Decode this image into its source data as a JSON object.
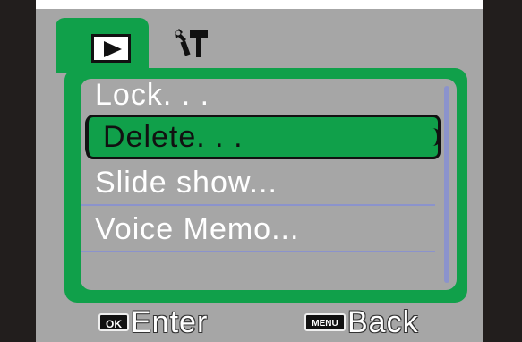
{
  "tabs": [
    {
      "icon": "play-icon",
      "active": true
    },
    {
      "icon": "tools-icon",
      "active": false
    }
  ],
  "menu": {
    "items": [
      {
        "label": "Lock. . ."
      },
      {
        "label": "Delete. . ."
      },
      {
        "label": "Slide show..."
      },
      {
        "label": "Voice Memo..."
      }
    ],
    "selected_index": 1
  },
  "footer": {
    "ok_badge": "OK",
    "ok_label": "Enter",
    "menu_badge": "MENU",
    "menu_label": "Back"
  },
  "colors": {
    "accent": "#10a04a",
    "screen_bg": "#a6a6a6",
    "bezel": "#221e1d",
    "divider": "#8b93cc"
  }
}
